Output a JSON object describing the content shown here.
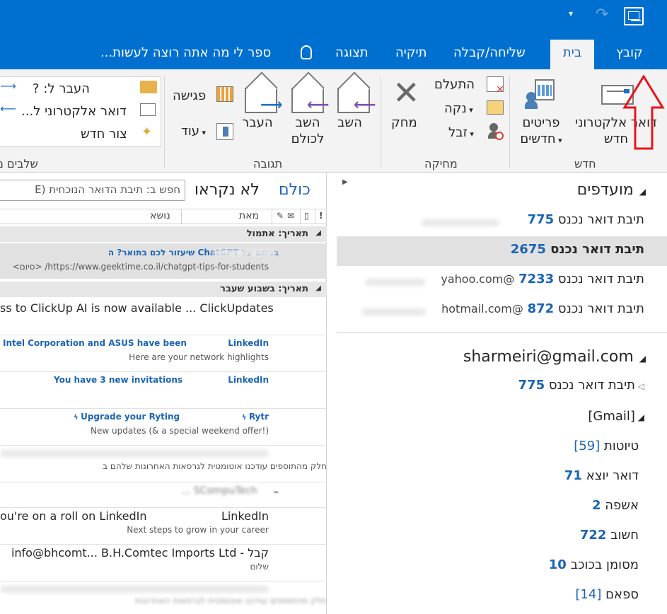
{
  "titlebar": {
    "quick_access": [
      "▾",
      "↷"
    ],
    "tabs": {
      "file": "קובץ",
      "home": "בית",
      "send_receive": "שליחה/קבלה",
      "folder": "תיקיה",
      "view": "תצוגה",
      "tell_me": "ספר לי מה אתה רוצה לעשות..."
    }
  },
  "ribbon": {
    "groups": {
      "new": "חדש",
      "delete": "מחיקה",
      "respond": "תגובה",
      "quick_steps": "שלבים מ"
    },
    "buttons": {
      "new_email_line1": "דואר אלקטרוני",
      "new_email_line2": "חדש",
      "new_items_line1": "פריטים",
      "new_items_line2": "חדשים",
      "ignore": "התעלם",
      "clean_up": "נקה",
      "junk": "זבל",
      "delete": "מחק",
      "reply": "השב",
      "reply_all_line1": "השב",
      "reply_all_line2": "לכולם",
      "forward": "העבר",
      "meeting": "פגישה",
      "more": "עוד",
      "move_to": "העבר ל: ?",
      "email_to": "דואר אלקטרוני ל...",
      "create_new": "צור חדש"
    }
  },
  "message_list": {
    "filter_all": "כולם",
    "filter_unread": "לא נקראו",
    "search_placeholder": "חפש ב: תיבת הדואר הנוכחית (E",
    "columns": {
      "subject": "נושא",
      "from": "מאת"
    },
    "groups": {
      "today": "תאריך: אתמול",
      "last_week": "תאריך: בשבוע שעבר"
    },
    "messages": [
      {
        "line1": "בניתם על ChatGPT שיעזור לכם בתואר? ה",
        "line2": "https://www.geektime.co.il/chatgpt-tips-for-students/  <סיום>"
      },
      {
        "subject": "ss to ClickUp AI is now available ... ClickUpdates"
      },
      {
        "from": "LinkedIn",
        "subject": "Intel Corporation and ASUS have been",
        "preview": "Here are your network highlights"
      },
      {
        "from": "LinkedIn",
        "subject": "You have 3 new invitations"
      },
      {
        "from": "Rytr",
        "subject": "Upgrade your Ryting",
        "preview": "New updates (& a special weekend offer!)"
      },
      {
        "preview": "חלק מהתוספים עודכנו אוטומטית לגרסאות האחרונות שלהם ב"
      },
      {
        "subject": "... SCompuTech"
      },
      {
        "from": "LinkedIn",
        "subject": "ou're on a roll on LinkedIn",
        "preview": "Next steps to grow in your career"
      },
      {
        "subject": "info@bhcomt... B.H.Comtec Imports Ltd - קבל",
        "preview": "שלום"
      },
      {
        "preview": "חלק מהתוספים עודכנו אוטומטית לגרסאות האחרונות"
      }
    ]
  },
  "folder_pane": {
    "favorites_title": "מועדפים",
    "favorites": [
      {
        "name": "תיבת דואר נכנס",
        "count": "775",
        "account": ""
      },
      {
        "name": "תיבת דואר נכנס",
        "count": "2675",
        "account": ""
      },
      {
        "name": "תיבת דואר נכנס",
        "count": "7233",
        "account": "@yahoo.com"
      },
      {
        "name": "תיבת דואר נכנס",
        "count": "872",
        "account": "@hotmail.com"
      }
    ],
    "account_title": "sharmeiri@gmail.com",
    "inbox": {
      "name": "תיבת דואר נכנס",
      "count": "775"
    },
    "gmail_title": "[Gmail]",
    "gmail_folders": [
      {
        "name": "טיוטות",
        "count": "[59]"
      },
      {
        "name": "דואר יוצא",
        "count": "71"
      },
      {
        "name": "אשפה",
        "count": "2"
      },
      {
        "name": "חשוב",
        "count": "722"
      },
      {
        "name": "מסומן בכוכב",
        "count": "10"
      },
      {
        "name": "ספאם",
        "count": "[14]"
      }
    ]
  },
  "colors": {
    "titlebar": "#0070d0",
    "accent": "#1b64b6",
    "annotation": "#e8141c"
  }
}
